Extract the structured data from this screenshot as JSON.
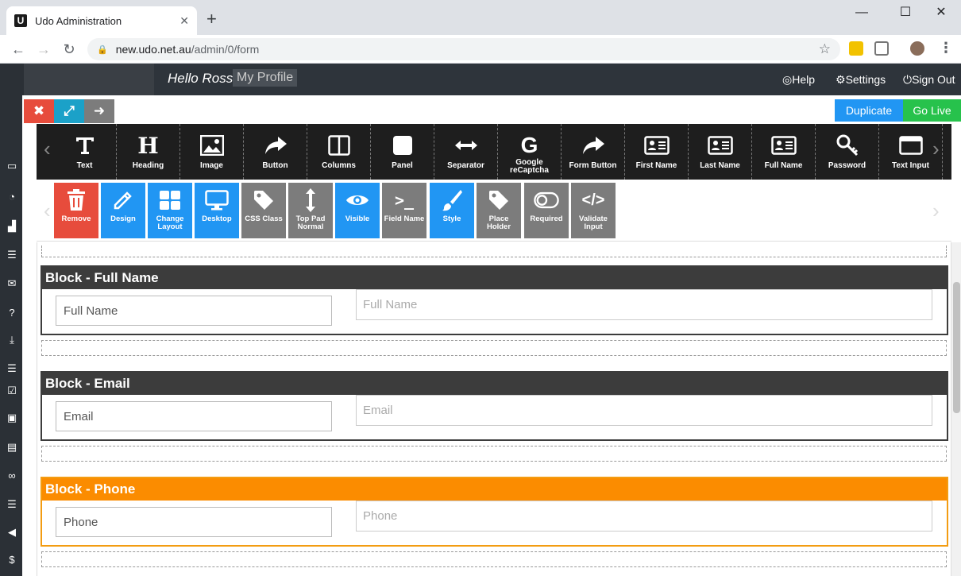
{
  "browser": {
    "tab_title": "Udo Administration",
    "tab_favicon": "U",
    "url_host": "new.udo.net.au",
    "url_path": "/admin/0/form",
    "new_tab": "+",
    "minimize": "—",
    "maximize": "☐",
    "close": "✕"
  },
  "app_header": {
    "greeting": "Hello Ross",
    "profile_link": "My Profile",
    "help": "Help",
    "settings": "Settings",
    "signout": "Sign Out"
  },
  "actions": {
    "duplicate": "Duplicate",
    "go_live": "Go Live"
  },
  "toolbar": [
    {
      "label": "Text",
      "icon": "text-icon"
    },
    {
      "label": "Heading",
      "icon": "heading-icon"
    },
    {
      "label": "Image",
      "icon": "image-icon"
    },
    {
      "label": "Button",
      "icon": "share-arrow-icon"
    },
    {
      "label": "Columns",
      "icon": "columns-icon"
    },
    {
      "label": "Panel",
      "icon": "panel-icon"
    },
    {
      "label": "Separator",
      "icon": "separator-icon"
    },
    {
      "label": "Google reCaptcha",
      "icon": "google-icon"
    },
    {
      "label": "Form Button",
      "icon": "share-arrow-icon"
    },
    {
      "label": "First Name",
      "icon": "id-card-icon"
    },
    {
      "label": "Last Name",
      "icon": "id-card-icon"
    },
    {
      "label": "Full Name",
      "icon": "id-card-icon"
    },
    {
      "label": "Password",
      "icon": "key-icon"
    },
    {
      "label": "Text Input",
      "icon": "text-input-icon"
    }
  ],
  "props": [
    {
      "label": "Remove",
      "icon": "trash-icon",
      "color": "#e74c3c"
    },
    {
      "label": "Design",
      "icon": "pencil-icon",
      "color": "#2196f3"
    },
    {
      "label": "Change Layout",
      "icon": "grid-icon",
      "color": "#2196f3"
    },
    {
      "label": "Desktop",
      "icon": "monitor-icon",
      "color": "#2196f3"
    },
    {
      "label": "CSS Class",
      "icon": "tag-icon",
      "color": "#7c7c7c"
    },
    {
      "label": "Top Pad Normal",
      "icon": "vertical-arrows-icon",
      "color": "#7c7c7c"
    },
    {
      "label": "Visible",
      "icon": "eye-icon",
      "color": "#2196f3"
    },
    {
      "label": "Field Name",
      "icon": "terminal-icon",
      "color": "#7c7c7c"
    },
    {
      "label": "Style",
      "icon": "brush-icon",
      "color": "#2196f3"
    },
    {
      "label": "Place Holder",
      "icon": "tag-icon",
      "color": "#7c7c7c"
    },
    {
      "label": "Required",
      "icon": "toggle-icon",
      "color": "#7c7c7c"
    },
    {
      "label": "Validate Input",
      "icon": "code-icon",
      "color": "#7c7c7c"
    }
  ],
  "blocks": [
    {
      "title": "Block - Full Name",
      "label": "Full Name",
      "placeholder": "Full Name"
    },
    {
      "title": "Block - Email",
      "label": "Email",
      "placeholder": "Email"
    },
    {
      "title": "Block - Phone",
      "label": "Phone",
      "placeholder": "Phone"
    }
  ]
}
